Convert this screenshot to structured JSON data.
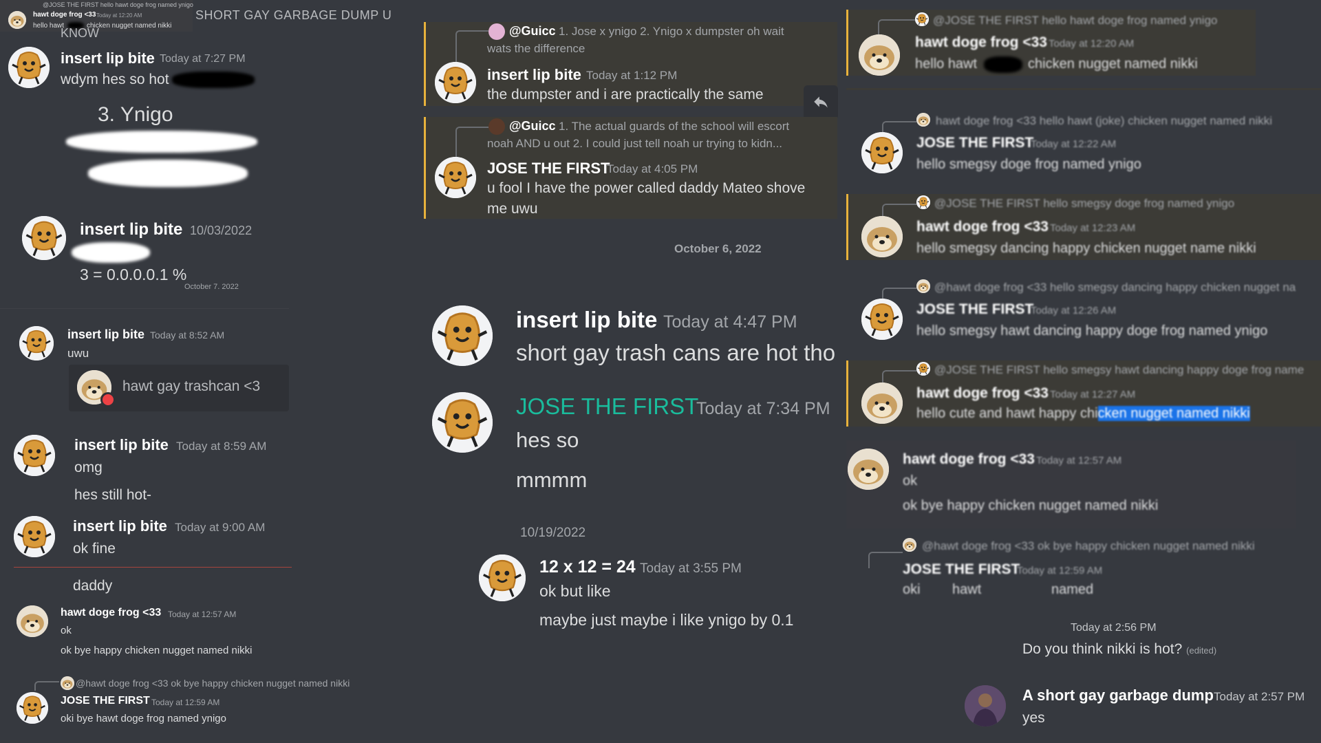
{
  "colors": {
    "background": "#36393f",
    "highlight": "#3c3b36",
    "highlight_bar": "#e8b23c",
    "teal_name": "#1abc9c",
    "selection": "#1a73e8"
  },
  "icons": {
    "nugget_avatar": "chicken-nugget-avatar",
    "doge_avatar": "doge-frog-avatar",
    "reply": "reply-arrow-icon"
  },
  "left": {
    "header_title": "SHORT GAY GARBAGE DUMP U",
    "header_know": "KNOW",
    "thumb": {
      "reply_text": "@JOSE THE FIRST hello hawt doge frog named ynigo",
      "name": "hawt doge frog <33",
      "time": "Today at 12:20 AM",
      "text_a": "hello hawt",
      "text_b": "chicken nugget named nikki"
    },
    "m1": {
      "name": "insert lip bite",
      "time": "Today at 7:27 PM",
      "text": "wdym hes so hot"
    },
    "ynigo_label": "3. Ynigo",
    "m2": {
      "name": "insert lip bite",
      "time": "10/03/2022",
      "text": "3 = 0.0.0.0.1 %",
      "date_fragment": "October 7, 2022"
    },
    "m3": {
      "name": "insert lip bite",
      "time": "Today at 8:52 AM",
      "text": "uwu",
      "embed_text": "hawt gay trashcan <3"
    },
    "m4": {
      "name": "insert lip bite",
      "time": "Today at 8:59 AM",
      "line1": "omg",
      "line2": "hes still hot-"
    },
    "m5": {
      "name": "insert lip bite",
      "time": "Today at 9:00 AM",
      "text": "ok fine"
    },
    "daddy": "daddy",
    "m6": {
      "name": "hawt doge frog <33",
      "time": "Today at 12:57 AM",
      "line1": "ok",
      "line2": "ok bye happy chicken nugget named nikki"
    },
    "m7": {
      "reply": "@hawt doge frog <33 ok bye happy chicken nugget named nikki",
      "name": "JOSE THE FIRST",
      "time": "Today at 12:59 AM",
      "text": "oki bye hawt doge frog named ynigo"
    }
  },
  "middle": {
    "r1": {
      "reply_user": "@Guicc",
      "reply_text_1": "1. Jose x ynigo 2. Ynigo x dumpster oh wait",
      "reply_text_2": "wats the difference",
      "name": "insert lip bite",
      "time": "Today at 1:12 PM",
      "text": "the dumpster and i are practically the same"
    },
    "r2": {
      "reply_user": "@Guicc",
      "reply_text_1": "1. The actual guards of the school will escort",
      "reply_text_2": "noah AND u out 2. I could just tell noah ur trying to kidn...",
      "name": "JOSE THE FIRST",
      "time": "Today at 4:05 PM",
      "line1": "u fool I have the power called daddy Mateo shove",
      "line2": "me uwu"
    },
    "date1": "October 6, 2022",
    "big1": {
      "name": "insert lip bite",
      "time": "Today at 4:47 PM",
      "text": "short gay trash cans are hot tho"
    },
    "big2": {
      "name": "JOSE THE FIRST",
      "time": "Today at 7:34 PM",
      "line1": "hes so",
      "line2": "mmmm"
    },
    "date2": "10/19/2022",
    "m3": {
      "name": "12 x 12 = 24",
      "time": "Today at 3:55 PM",
      "line1": "ok but like",
      "line2": "maybe just maybe i like ynigo by 0.1"
    }
  },
  "right": {
    "b1": {
      "reply": "@JOSE THE FIRST hello hawt doge frog named ynigo",
      "name": "hawt doge frog <33",
      "time": "Today at 12:20 AM",
      "text_a": "hello hawt",
      "text_b": "chicken nugget named nikki"
    },
    "b2": {
      "reply": "hawt doge frog <33 hello hawt (joke) chicken nugget named nikki",
      "name": "JOSE THE FIRST",
      "time": "Today at 12:22 AM",
      "text": "hello smegsy doge frog named ynigo"
    },
    "b3": {
      "reply": "@JOSE THE FIRST hello smegsy doge frog named ynigo",
      "name": "hawt doge frog <33",
      "time": "Today at 12:23 AM",
      "text": "hello smegsy dancing happy chicken nugget name nikki"
    },
    "b4": {
      "reply": "@hawt doge frog <33 hello smegsy dancing happy chicken nugget na",
      "name": "JOSE THE FIRST",
      "time": "Today at 12:26 AM",
      "text": "hello smegsy hawt dancing happy doge frog named ynigo"
    },
    "b5": {
      "reply": "@JOSE THE FIRST hello smegsy hawt dancing happy doge frog name",
      "name": "hawt doge frog <33",
      "time": "Today at 12:27 AM",
      "text_a": "hello cute and hawt happy chi",
      "text_b": "cken nugget named nikki"
    },
    "b6": {
      "name": "hawt doge frog <33",
      "time": "Today at 12:57 AM",
      "line1": "ok",
      "line2": "ok bye happy chicken nugget named nikki"
    },
    "b7": {
      "reply": "@hawt doge frog <33 ok bye happy chicken nugget named nikki",
      "name": "JOSE THE FIRST",
      "time": "Today at 12:59 AM",
      "w1": "oki",
      "w2": "hawt",
      "w3": "named"
    },
    "time_line": "Today at 2:56 PM",
    "question": "Do you think nikki is hot?",
    "edited": "(edited)",
    "last": {
      "name": "A short gay garbage dump",
      "time": "Today at 2:57 PM",
      "text": "yes"
    }
  }
}
